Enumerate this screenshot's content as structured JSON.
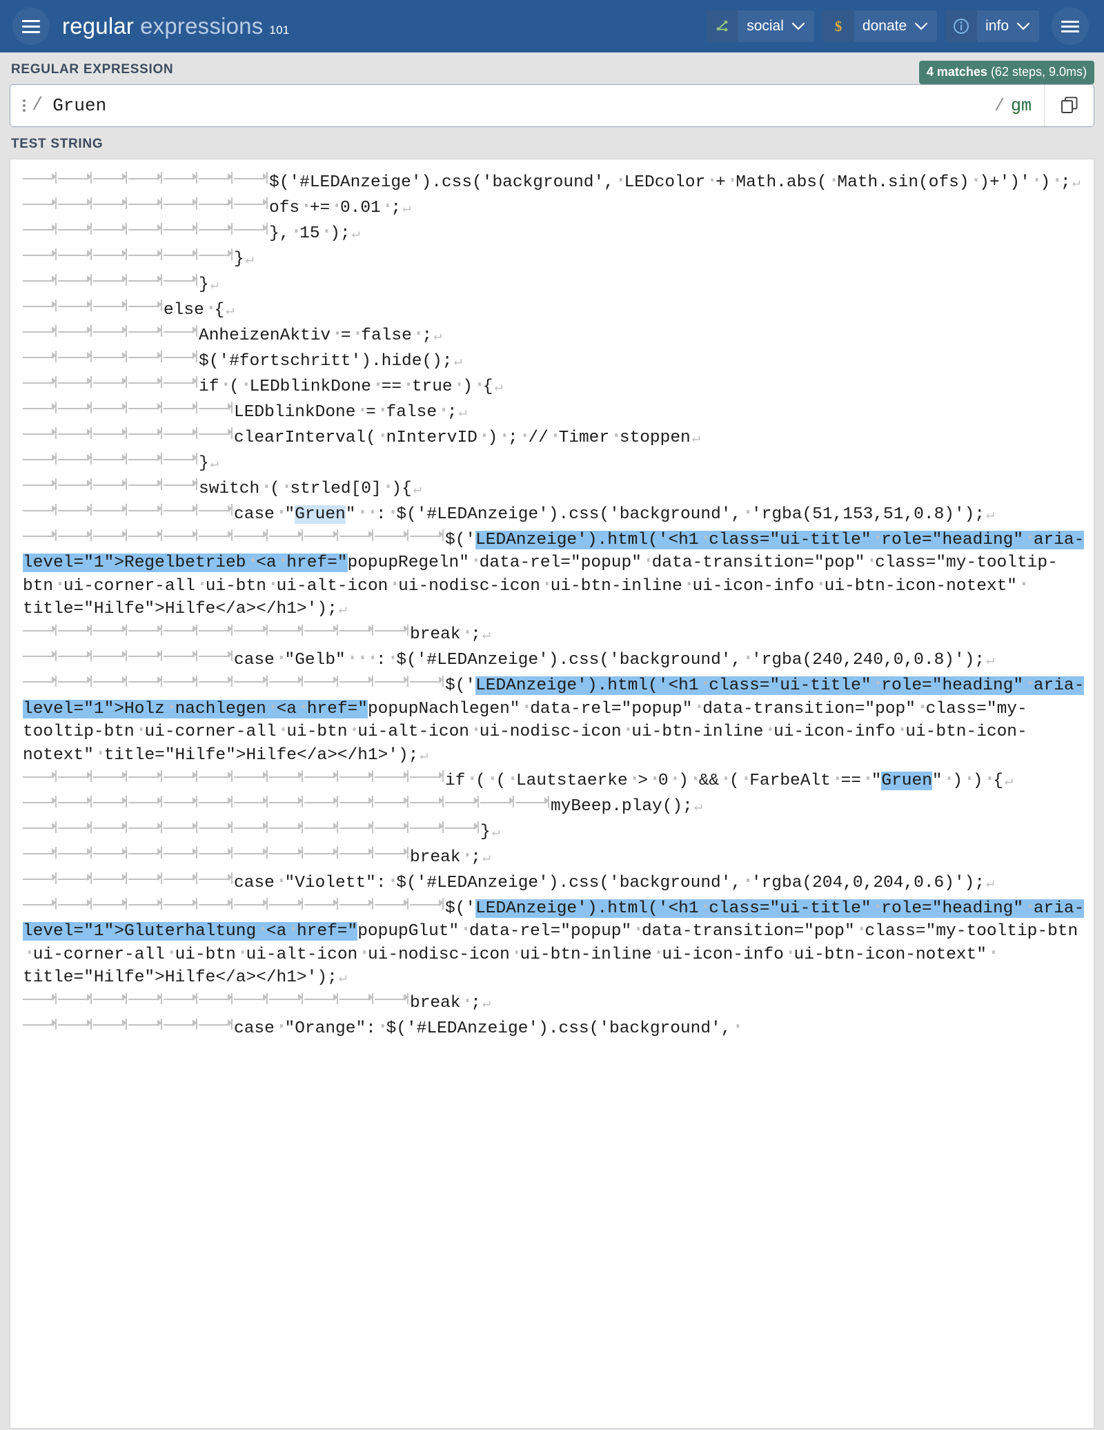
{
  "header": {
    "menu_icon": "hamburger-icon",
    "brand_part1": "regular",
    "brand_part2": "expressions",
    "brand_part3": "101",
    "buttons": [
      {
        "label": "social",
        "icon": "share-nodes-icon",
        "caret": "chevron-down-icon"
      },
      {
        "label": "donate",
        "icon": "dollar-icon",
        "caret": "chevron-down-icon"
      },
      {
        "label": "info",
        "icon": "info-circle-icon",
        "caret": "chevron-down-icon"
      }
    ],
    "right_menu_icon": "hamburger-icon"
  },
  "regex_section": {
    "title": "REGULAR EXPRESSION",
    "matches_count": "4 matches",
    "matches_detail": " (62 steps, 9.0ms)",
    "open_slash": "/",
    "pattern": "Gruen",
    "close_slash": "/",
    "flags": "gm",
    "options_icon": "kebab-menu-icon",
    "copy_icon": "copy-icon"
  },
  "test_section": {
    "title": "TEST STRING",
    "lines": [
      {
        "tabs": 7,
        "text": "$('#LEDAnzeige').css('background',~LEDcolor~+~Math.abs(~Math.sin(ofs)~)+')'~)~;",
        "nl": true
      },
      {
        "tabs": 7,
        "text": "ofs~+=~0.01~;",
        "nl": true
      },
      {
        "tabs": 7,
        "text": "},~15~);",
        "nl": true
      },
      {
        "tabs": 6,
        "text": "}",
        "nl": true
      },
      {
        "tabs": 5,
        "text": "}",
        "nl": true
      },
      {
        "tabs": 4,
        "text": "else~{",
        "nl": true
      },
      {
        "tabs": 5,
        "text": "AnheizenAktiv~=~false~;",
        "nl": true
      },
      {
        "tabs": 5,
        "text": "$('#fortschritt').hide();",
        "nl": true
      },
      {
        "tabs": 5,
        "text": "if~(~LEDblinkDone~==~true~)~{",
        "nl": true
      },
      {
        "tabs": 6,
        "text": "LEDblinkDone~=~false~;",
        "nl": true
      },
      {
        "tabs": 6,
        "text": "clearInterval(~nIntervID~)~;~//~Timer~stoppen",
        "nl": true
      },
      {
        "tabs": 5,
        "text": "}",
        "nl": true
      },
      {
        "tabs": 5,
        "text": "switch~(~strled[0]~){",
        "nl": true
      },
      {
        "tabs": 6,
        "text": "case~\"@Gruen@\"~~:~$('#LEDAnzeige').css('background',~'rgba(51,153,51,0.8)');",
        "nl": true
      },
      {
        "tabs": 12,
        "text": "$('#LEDAnzeige').html('<h1~class=\"ui-title\"~role=\"heading\"~aria-level=\"1\">Regelbetrieb~<a~href=\"#popupRegeln\"~data-rel=\"popup\"~data-transition=\"pop\"~class=\"my-tooltip-btn~ui-corner-all~ui-btn~ui-alt-icon~ui-nodisc-icon~ui-btn-inline~ui-icon-info~ui-btn-icon-notext\"~title=\"Hilfe\">Hilfe</a></h1>');",
        "nl": true
      },
      {
        "tabs": 11,
        "text": "break~;",
        "nl": true
      },
      {
        "tabs": 6,
        "text": "case~\"Gelb\"~~~:~$('#LEDAnzeige').css('background',~'rgba(240,240,0,0.8)');",
        "nl": true
      },
      {
        "tabs": 12,
        "text": "$('#LEDAnzeige').html('<h1~class=\"ui-title\"~role=\"heading\"~aria-level=\"1\">Holz~nachlegen~<a~href=\"#popupNachlegen\"~data-rel=\"popup\"~data-transition=\"pop\"~class=\"my-tooltip-btn~ui-corner-all~ui-btn~ui-alt-icon~ui-nodisc-icon~ui-btn-inline~ui-icon-info~ui-btn-icon-notext\"~title=\"Hilfe\">Hilfe</a></h1>');",
        "nl": true
      },
      {
        "tabs": 12,
        "text": "if~(~(~Lautstaerke~>~0~)~&&~(~FarbeAlt~==~\"#Gruen#\"~)~)~{",
        "nl": true
      },
      {
        "tabs": 15,
        "text": "myBeep.play();",
        "nl": true
      },
      {
        "tabs": 13,
        "text": "}",
        "nl": true
      },
      {
        "tabs": 11,
        "text": "break~;",
        "nl": true
      },
      {
        "tabs": 6,
        "text": "case~\"Violett\":~$('#LEDAnzeige').css('background',~'rgba(204,0,204,0.6)');",
        "nl": true
      },
      {
        "tabs": 12,
        "text": "$('#LEDAnzeige').html('<h1~class=\"ui-title\"~role=\"heading\"~aria-level=\"1\">Gluterhaltung~<a~href=\"#popupGlut\"~data-rel=\"popup\"~data-transition=\"pop\"~class=\"my-tooltip-btn~ui-corner-all~ui-btn~ui-alt-icon~ui-nodisc-icon~ui-btn-inline~ui-icon-info~ui-btn-icon-notext\"~title=\"Hilfe\">Hilfe</a></h1>');",
        "nl": true
      },
      {
        "tabs": 11,
        "text": "break~;",
        "nl": true
      },
      {
        "tabs": 6,
        "text": "case~\"Orange\":~$('#LEDAnzeige').css('background',~",
        "nl": false
      }
    ]
  },
  "colors": {
    "header_bg": "#2a5a94",
    "page_bg": "#e3e3e3",
    "badge_bg": "#4a8074",
    "match_highlight": "#cde3f7",
    "match_selected": "#8cc2f0",
    "flags_text": "#246b3f"
  }
}
